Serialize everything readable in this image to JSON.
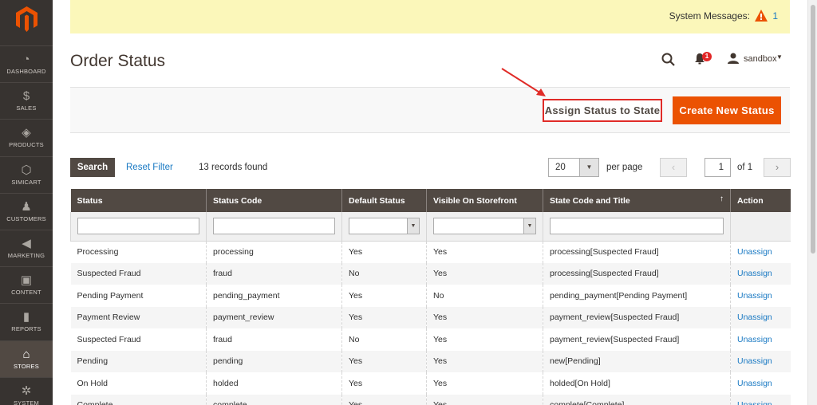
{
  "sidebar": {
    "items": [
      {
        "label": "DASHBOARD",
        "icon": "dashboard-icon",
        "glyph": "◔"
      },
      {
        "label": "SALES",
        "icon": "dollar-icon",
        "glyph": "$"
      },
      {
        "label": "PRODUCTS",
        "icon": "cube-icon",
        "glyph": "◈"
      },
      {
        "label": "SIMICART",
        "icon": "hexagon-icon",
        "glyph": "⬡"
      },
      {
        "label": "CUSTOMERS",
        "icon": "person-icon",
        "glyph": "♟"
      },
      {
        "label": "MARKETING",
        "icon": "megaphone-icon",
        "glyph": "◀"
      },
      {
        "label": "CONTENT",
        "icon": "layout-icon",
        "glyph": "▣"
      },
      {
        "label": "REPORTS",
        "icon": "bar-chart-icon",
        "glyph": "▮"
      },
      {
        "label": "STORES",
        "icon": "store-icon",
        "glyph": "⌂"
      },
      {
        "label": "SYSTEM",
        "icon": "gear-icon",
        "glyph": "✲"
      }
    ]
  },
  "system_messages": {
    "label": "System Messages:",
    "count": "1"
  },
  "header": {
    "title": "Order Status",
    "notification_count": "1",
    "username": "sandbox"
  },
  "actions": {
    "assign": "Assign Status to State",
    "create": "Create New Status"
  },
  "toolbar": {
    "search": "Search",
    "reset": "Reset Filter",
    "records": "13 records found",
    "per_page_value": "20",
    "per_page_label": "per page",
    "page": "1",
    "of_pages": "of 1"
  },
  "columns": [
    "Status",
    "Status Code",
    "Default Status",
    "Visible On Storefront",
    "State Code and Title",
    "Action"
  ],
  "rows": [
    [
      "Processing",
      "processing",
      "Yes",
      "Yes",
      "processing[Suspected Fraud]",
      "Unassign"
    ],
    [
      "Suspected Fraud",
      "fraud",
      "No",
      "Yes",
      "processing[Suspected Fraud]",
      "Unassign"
    ],
    [
      "Pending Payment",
      "pending_payment",
      "Yes",
      "No",
      "pending_payment[Pending Payment]",
      "Unassign"
    ],
    [
      "Payment Review",
      "payment_review",
      "Yes",
      "Yes",
      "payment_review[Suspected Fraud]",
      "Unassign"
    ],
    [
      "Suspected Fraud",
      "fraud",
      "No",
      "Yes",
      "payment_review[Suspected Fraud]",
      "Unassign"
    ],
    [
      "Pending",
      "pending",
      "Yes",
      "Yes",
      "new[Pending]",
      "Unassign"
    ],
    [
      "On Hold",
      "holded",
      "Yes",
      "Yes",
      "holded[On Hold]",
      "Unassign"
    ],
    [
      "Complete",
      "complete",
      "Yes",
      "Yes",
      "complete[Complete]",
      "Unassign"
    ]
  ],
  "colors": {
    "accent": "#eb5202",
    "sidebar": "#373330",
    "header": "#514943",
    "link": "#1979c3",
    "highlight": "#e02b27"
  }
}
